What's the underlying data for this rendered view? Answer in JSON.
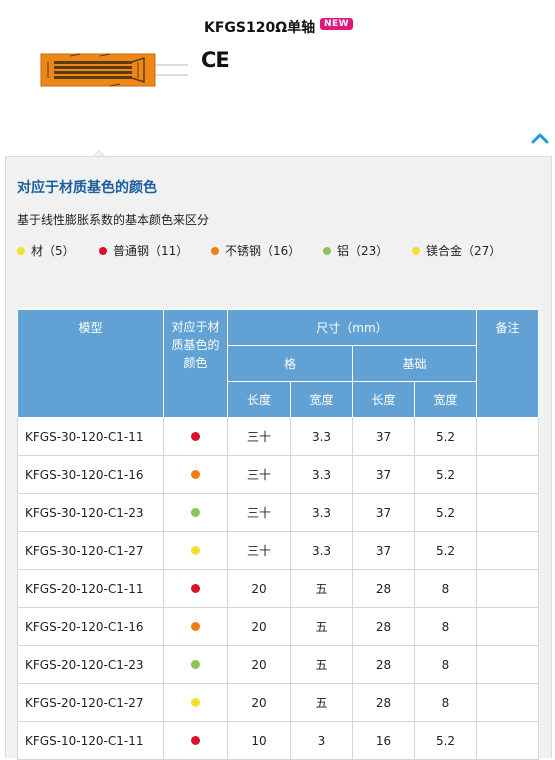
{
  "product": {
    "title": "KFGS120Ω单轴",
    "badge": "NEW",
    "certification": "CE",
    "gauge_image_icon": "strain-gauge-image"
  },
  "collapse_icon": "chevron-up-icon",
  "panel": {
    "title": "对应于材质基色的颜色",
    "description": "基于线性膨胀系数的基本颜色来区分",
    "legend": [
      {
        "label": "材（5）",
        "color": "#f3e035"
      },
      {
        "label": "普通钢（11）",
        "color": "#d9102a"
      },
      {
        "label": "不锈钢（16）",
        "color": "#ee7d0f"
      },
      {
        "label": "铝（23）",
        "color": "#8cc455"
      },
      {
        "label": "镁合金（27）",
        "color": "#f3e035"
      }
    ]
  },
  "table": {
    "headers": {
      "model": "模型",
      "color": "对应于材质基色的颜色",
      "size": "尺寸（mm）",
      "remarks": "备注",
      "grid": "格",
      "base": "基础",
      "length": "长度",
      "width": "宽度"
    },
    "rows": [
      {
        "model": "KFGS-30-120-C1-11",
        "color": "#d9102a",
        "grid_length": "三十",
        "grid_width": "3.3",
        "base_length": "37",
        "base_width": "5.2",
        "remarks": ""
      },
      {
        "model": "KFGS-30-120-C1-16",
        "color": "#ee7d0f",
        "grid_length": "三十",
        "grid_width": "3.3",
        "base_length": "37",
        "base_width": "5.2",
        "remarks": ""
      },
      {
        "model": "KFGS-30-120-C1-23",
        "color": "#8cc455",
        "grid_length": "三十",
        "grid_width": "3.3",
        "base_length": "37",
        "base_width": "5.2",
        "remarks": ""
      },
      {
        "model": "KFGS-30-120-C1-27",
        "color": "#f3e035",
        "grid_length": "三十",
        "grid_width": "3.3",
        "base_length": "37",
        "base_width": "5.2",
        "remarks": ""
      },
      {
        "model": "KFGS-20-120-C1-11",
        "color": "#d9102a",
        "grid_length": "20",
        "grid_width": "五",
        "base_length": "28",
        "base_width": "8",
        "remarks": ""
      },
      {
        "model": "KFGS-20-120-C1-16",
        "color": "#ee7d0f",
        "grid_length": "20",
        "grid_width": "五",
        "base_length": "28",
        "base_width": "8",
        "remarks": ""
      },
      {
        "model": "KFGS-20-120-C1-23",
        "color": "#8cc455",
        "grid_length": "20",
        "grid_width": "五",
        "base_length": "28",
        "base_width": "8",
        "remarks": ""
      },
      {
        "model": "KFGS-20-120-C1-27",
        "color": "#f3e035",
        "grid_length": "20",
        "grid_width": "五",
        "base_length": "28",
        "base_width": "8",
        "remarks": ""
      },
      {
        "model": "KFGS-10-120-C1-11",
        "color": "#d9102a",
        "grid_length": "10",
        "grid_width": "3",
        "base_length": "16",
        "base_width": "5.2",
        "remarks": ""
      }
    ]
  }
}
